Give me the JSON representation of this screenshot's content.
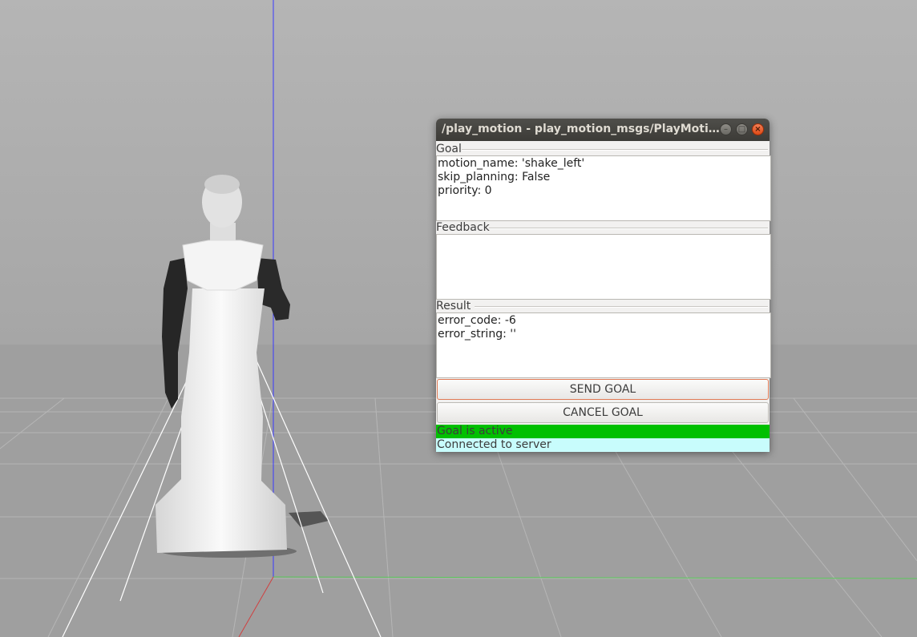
{
  "window": {
    "title": "/play_motion - play_motion_msgs/PlayMotion ...",
    "minimize_icon": "minimize-icon",
    "maximize_icon": "maximize-icon",
    "close_icon": "close-icon"
  },
  "goal": {
    "label": "Goal",
    "lines": [
      "motion_name: 'shake_left'",
      "skip_planning: False",
      "priority: 0"
    ]
  },
  "feedback": {
    "label": "Feedback",
    "lines": []
  },
  "result": {
    "label": "Result",
    "lines": [
      "error_code: -6",
      "error_string: ''"
    ]
  },
  "buttons": {
    "send_goal": "SEND GOAL",
    "cancel_goal": "CANCEL GOAL"
  },
  "status": {
    "goal_state": "Goal is active",
    "goal_state_color": "#00c000",
    "connection": "Connected to server",
    "connection_color": "#c8fcfc"
  },
  "scene": {
    "background_color": "#b2b2b2",
    "ground_color": "#a0a0a0",
    "z_axis_color": "#3c3cff",
    "x_axis_color": "#d04040",
    "y_axis_color": "#40c040"
  }
}
